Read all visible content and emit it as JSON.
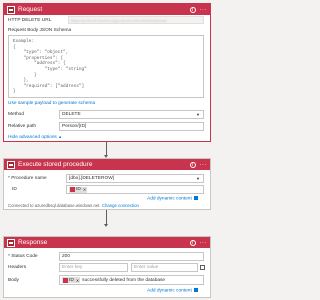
{
  "request": {
    "title": "Request",
    "http_url_label": "HTTP DELETE URL",
    "http_url_value": "https://prod-00.westus.logic.azure.com:443/workflows/",
    "schema_label": "Request Body JSON Schema",
    "schema_lines": [
      "Example:",
      "{",
      "    \"type\": \"object\",",
      "    \"properties\": {",
      "        \"address\": {",
      "            \"type\": \"string\"",
      "        }",
      "    },",
      "    \"required\": [\"address\"]",
      "}"
    ],
    "sample_payload_link": "Use sample payload to generate schema",
    "method_label": "Method",
    "method_value": "DELETE",
    "relative_path_label": "Relative path",
    "relative_path_value": "Person/{ID}",
    "hide_advanced_link": "Hide advanced options"
  },
  "stored_proc": {
    "title": "Execute stored procedure",
    "procedure_label": "* Procedure name",
    "procedure_value": "[dbo].[DELETEROW]",
    "id_label": "ID",
    "add_dynamic": "Add dynamic content",
    "connected_text": "Connected to azuredbsql.database.windows.net.",
    "change_connection": "Change connection"
  },
  "response": {
    "title": "Response",
    "status_code_label": "* Status Code",
    "status_code_value": "200",
    "headers_label": "Headers",
    "enter_key_placeholder": "Enter key",
    "enter_value_placeholder": "Enter value",
    "body_label": "Body",
    "body_token": "ID",
    "body_text": "successfully deleted from the database",
    "add_dynamic": "Add dynamic content"
  }
}
